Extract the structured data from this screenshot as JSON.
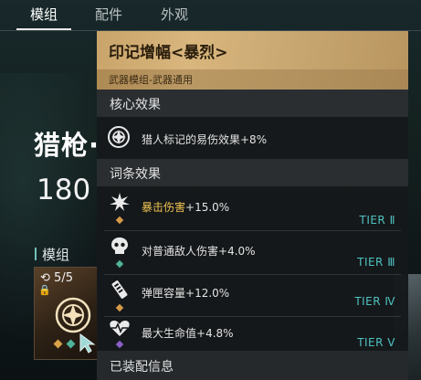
{
  "tabs": [
    {
      "label": "模组",
      "active": true
    },
    {
      "label": "配件",
      "active": false
    },
    {
      "label": "外观",
      "active": false
    }
  ],
  "weapon": {
    "name": "猎枪·",
    "stat": "180"
  },
  "mods_section": {
    "title": "模组"
  },
  "mod_card": {
    "count": "5/5"
  },
  "tooltip": {
    "title": "印记增幅<暴烈>",
    "subtitle": "武器模组-武器通用",
    "core": {
      "header": "核心效果",
      "text": "猎人标记的易伤效果+8%",
      "icon": "mark-target-icon"
    },
    "entries_header": "词条效果",
    "entries": [
      {
        "label": "暴击伤害",
        "value": "+15.0%",
        "highlight": true,
        "tier": "TIER Ⅱ",
        "icon": "crit-burst-icon",
        "gem_color": "#d59a48"
      },
      {
        "label": "对普通敌人伤害",
        "value": "+4.0%",
        "highlight": false,
        "tier": "TIER Ⅲ",
        "icon": "enemy-skull-icon",
        "gem_color": "#4fb39a"
      },
      {
        "label": "弹匣容量",
        "value": "+12.0%",
        "highlight": false,
        "tier": "TIER Ⅳ",
        "icon": "magazine-icon",
        "gem_color": "#d59a48"
      },
      {
        "label": "最大生命值",
        "value": "+4.8%",
        "highlight": false,
        "tier": "TIER Ⅴ",
        "icon": "heart-pulse-icon",
        "gem_color": "#8a5fc9"
      }
    ],
    "footer": "已装配信息"
  },
  "colors": {
    "accent_gold": "#c9a46a",
    "tier_cyan": "#4fc3c2",
    "highlight_gold": "#f0c452"
  }
}
